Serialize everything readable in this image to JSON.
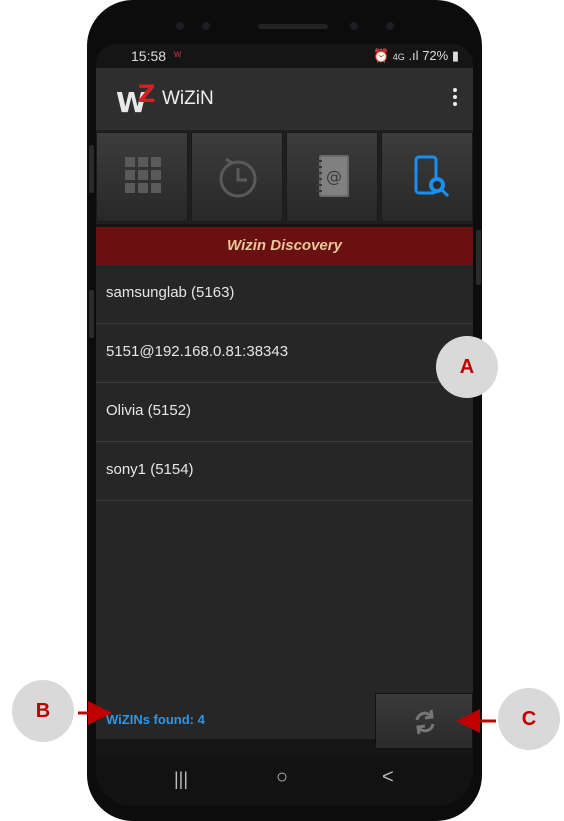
{
  "status_bar": {
    "time": "15:58",
    "notification": "w",
    "network": "4G",
    "battery": "72%"
  },
  "app_bar": {
    "title": "WiZiN",
    "logo_letters": [
      "W",
      "Z"
    ]
  },
  "tabs": [
    {
      "icon": "dialpad-icon"
    },
    {
      "icon": "history-clock-icon"
    },
    {
      "icon": "address-book-icon"
    },
    {
      "icon": "discovery-phone-search-icon",
      "active": true
    }
  ],
  "banner": {
    "title": "Wizin Discovery"
  },
  "devices": [
    {
      "label": "samsunglab (5163)"
    },
    {
      "label": "5151@192.168.0.81:38343"
    },
    {
      "label": "Olivia (5152)"
    },
    {
      "label": "sony1 (5154)"
    }
  ],
  "footer": {
    "found_text": "WiZINs found: 4"
  },
  "nav_bar": {
    "recents": "|||",
    "home": "○",
    "back": "<"
  },
  "callouts": {
    "a": "A",
    "b": "B",
    "c": "C"
  },
  "colors": {
    "banner": "#6b1010",
    "accent_blue": "#2e96e8",
    "callout_text": "#c00000"
  }
}
